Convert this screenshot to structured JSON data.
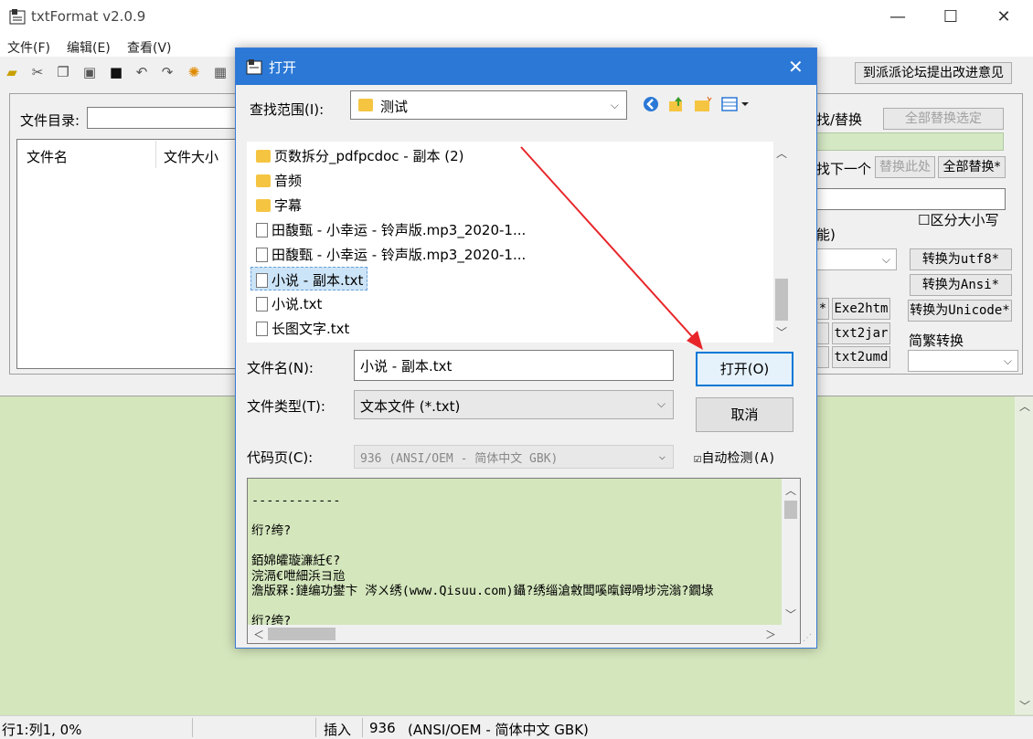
{
  "window": {
    "title": "txtFormat v2.0.9"
  },
  "menu": [
    "文件(F)",
    "编辑(E)",
    "查看(V)"
  ],
  "left": {
    "dir_label": "文件目录:",
    "col_name": "文件名",
    "col_size": "文件大小"
  },
  "right": {
    "forum_button": "到派派论坛提出改进意见",
    "find_replace": "找/替换",
    "replace_all_selected": "全部替换选定",
    "find_next": "找下一个",
    "replace_here": "替换此处",
    "replace_all": "全部替换*",
    "case_sensitive": "区分大小写",
    "encoding_note": "能)",
    "to_utf8": "转换为utf8*",
    "to_ansi": "转换为Ansi*",
    "to_unicode": "转换为Unicode*",
    "exe2htm": "Exe2htm",
    "txt2jar": "txt2jar",
    "txt2umd": "txt2umd",
    "trad_simp": "简繁转换",
    "btn_star": "*"
  },
  "status": {
    "position": "行1:列1, 0%",
    "mode": "插入",
    "codepage": "936",
    "encoding": "(ANSI/OEM - 简体中文 GBK)"
  },
  "dialog": {
    "title": "打开",
    "lookin_label": "查找范围(I):",
    "lookin_value": "测试",
    "files": [
      {
        "type": "folder",
        "name": "页数拆分_pdfpcdoc - 副本 (2)"
      },
      {
        "type": "folder",
        "name": "音频"
      },
      {
        "type": "folder",
        "name": "字幕"
      },
      {
        "type": "file",
        "name": "田馥甄 - 小幸运 - 铃声版.mp3_2020-1..."
      },
      {
        "type": "file",
        "name": "田馥甄 - 小幸运 - 铃声版.mp3_2020-1..."
      },
      {
        "type": "file",
        "name": "小说 - 副本.txt",
        "selected": true
      },
      {
        "type": "file",
        "name": "小说.txt"
      },
      {
        "type": "file",
        "name": "长图文字.txt"
      }
    ],
    "filename_label": "文件名(N):",
    "filename_value": "小说 - 副本.txt",
    "filetype_label": "文件类型(T):",
    "filetype_value": "文本文件 (*.txt)",
    "open_button": "打开(O)",
    "cancel_button": "取消",
    "codepage_label": "代码页(C):",
    "codepage_value": "936   (ANSI/OEM - 简体中文 GBK)",
    "autodetect": "自动检测(A)",
    "preview_lines": [
      "------------",
      "",
      "绗?绔?",
      "",
      "銆婂皬璇濓紝€?",
      "浣滆€呭細浜ヨ兘",
      "澹版槑:鏈编功鐢卞 涔ㄨ绣(www.Qisuu.com)鑷?绣缁滄敹闆嗘暣鐞嗗埗浣滃?鐗堟",
      "",
      "绗?绔?"
    ]
  }
}
